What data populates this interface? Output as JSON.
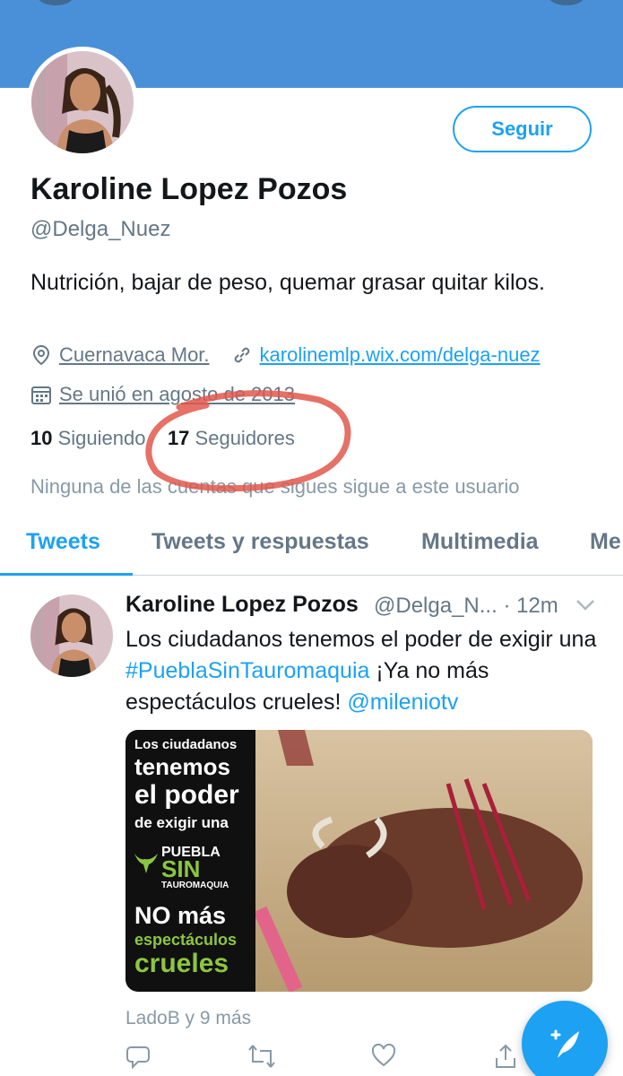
{
  "profile": {
    "name": "Karoline Lopez Pozos",
    "handle": "@Delga_Nuez",
    "follow_label": "Seguir",
    "bio": "Nutrición, bajar de peso, quemar grasar quitar kilos.",
    "location": "Cuernavaca Mor.",
    "website": "karolinemlp.wix.com/delga-nuez",
    "joined": "Se unió en agosto de 2013",
    "following_count": "10",
    "following_label": "Siguiendo",
    "followers_count": "17",
    "followers_label": "Seguidores",
    "mutual_text": "Ninguna de las cuentas que sigues sigue a este usuario"
  },
  "tabs": [
    {
      "label": "Tweets",
      "active": true
    },
    {
      "label": "Tweets y respuestas",
      "active": false
    },
    {
      "label": "Multimedia",
      "active": false
    },
    {
      "label": "Me",
      "active": false
    }
  ],
  "tweet": {
    "author_name": "Karoline Lopez Pozos",
    "author_handle": "@Delga_N...",
    "separator": "·",
    "time": "12m",
    "text_part1": "Los ciudadanos tenemos el poder de exigir una ",
    "hashtag": "#PueblaSinTauromaquia",
    "text_part2": " ¡Ya no más espectáculos crueles! ",
    "mention": "@mileniotv",
    "image_text": {
      "line1": "Los ciudadanos",
      "line2": "tenemos",
      "line3": "el poder",
      "line4": "de exigir una",
      "line5": "PUEBLA",
      "line6": "SIN",
      "line7": "TAUROMAQUIA",
      "line8": "NO más",
      "line9": "espectáculos",
      "line10": "crueles"
    },
    "social_context": "LadoB y 9 más"
  },
  "icons": {
    "location": "location-pin-icon",
    "link": "link-icon",
    "calendar": "calendar-icon",
    "reply": "reply-icon",
    "retweet": "retweet-icon",
    "like": "heart-icon",
    "share": "share-icon",
    "compose": "compose-tweet-icon"
  },
  "colors": {
    "accent": "#1da1f2",
    "banner": "#4a90d9",
    "annotation": "#e0584c"
  }
}
